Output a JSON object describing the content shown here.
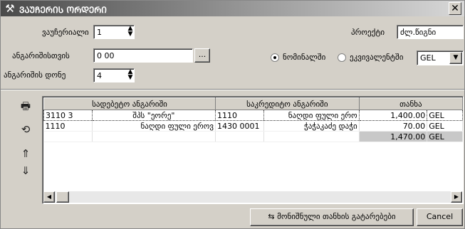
{
  "window": {
    "title": "ᲕᲐᲣᲩᲔᲠᲘᲡ ᲝᲠᲓᲔᲠᲘ",
    "close_symbol": "✕"
  },
  "form": {
    "voucher_label": "ვაუჩერიალი",
    "voucher_value": "1",
    "project_label": "პროექტი",
    "project_value": "ძლ.წიგნი",
    "accounts_label": "ანგარიშისთვის",
    "accounts_value": "0 00",
    "browse_label": "...",
    "account_level_label": "ანგარიშის დონე",
    "account_level_value": "4",
    "radio_national_label": "ნომინალში",
    "radio_equiv_label": "ეკვივალენტში",
    "currency_value": "GEL"
  },
  "table": {
    "columns": [
      "სადებეტო ანგარიში",
      "საკრედიტო ანგარიში",
      "თანხა"
    ],
    "rows": [
      {
        "debit_code": "3110 3",
        "debit_name": "შპს \"ეორე\"",
        "credit_code": "1110",
        "credit_name": "ნაღდი ფული ერო",
        "amount": "1,400.00",
        "currency": "GEL"
      },
      {
        "debit_code": "1110",
        "debit_name": "ნაღდი ფული ეროვ",
        "credit_code": "1430 0001",
        "credit_name": "ჭაჭაკაძე დაჭი",
        "amount": "70.00",
        "currency": "GEL"
      }
    ],
    "total_amount": "1,470.00",
    "total_currency": "GEL"
  },
  "footer": {
    "print_amount_label": "მონიშნული თანხის გატარებები",
    "cancel_label": "Cancel"
  }
}
